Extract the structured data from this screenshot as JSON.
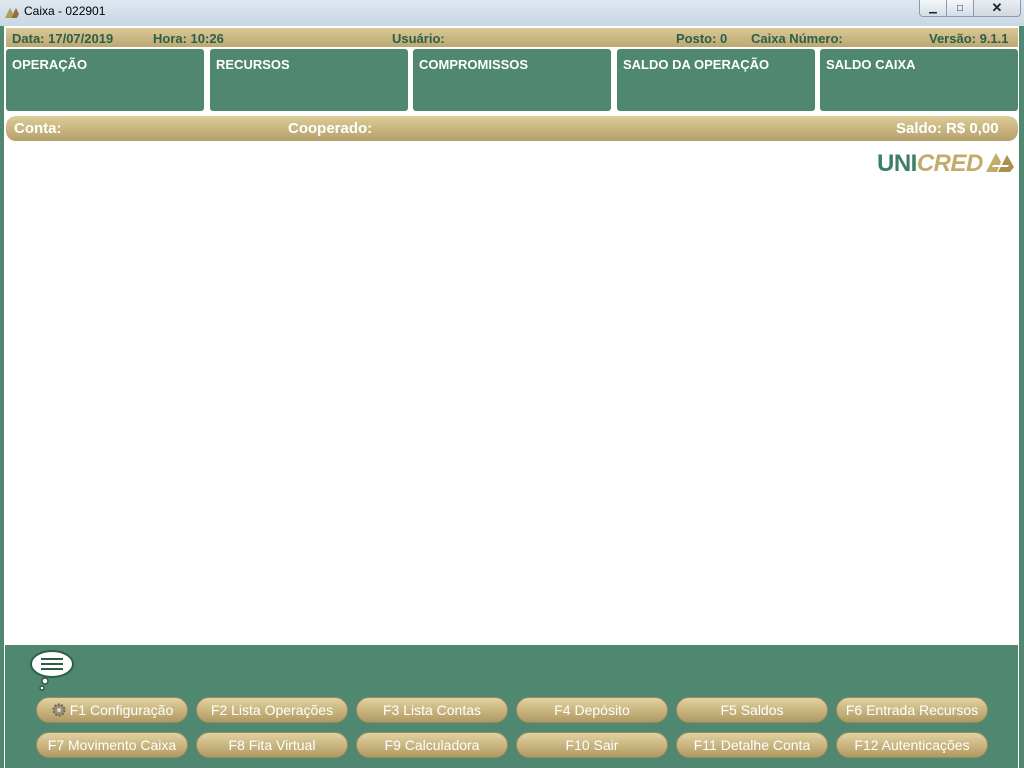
{
  "window": {
    "title": "Caixa - 022901",
    "min_label": "▁",
    "max_label": "□",
    "close_label": "✕"
  },
  "info": {
    "data": "Data: 17/07/2019",
    "hora": "Hora: 10:26",
    "usuario": "Usuário:",
    "posto": "Posto: 0",
    "caixa_numero": "Caixa Número:",
    "versao": "Versão: 9.1.1"
  },
  "panels": [
    {
      "label": "OPERAÇÃO"
    },
    {
      "label": "RECURSOS"
    },
    {
      "label": "COMPROMISSOS"
    },
    {
      "label": "SALDO DA OPERAÇÃO"
    },
    {
      "label": "SALDO CAIXA"
    }
  ],
  "account": {
    "conta": "Conta:",
    "cooperado": "Cooperado:",
    "saldo": "Saldo: R$ 0,00"
  },
  "logo": {
    "uni": "UNI",
    "cred": "CRED"
  },
  "fkeys": [
    {
      "label": "F1 Configuração",
      "icon": "gear-icon"
    },
    {
      "label": "F2 Lista Operações"
    },
    {
      "label": "F3 Lista Contas"
    },
    {
      "label": "F4 Depósito"
    },
    {
      "label": "F5 Saldos"
    },
    {
      "label": "F6 Entrada Recursos"
    },
    {
      "label": "F7 Movimento Caixa"
    },
    {
      "label": "F8 Fita Virtual"
    },
    {
      "label": "F9 Calculadora"
    },
    {
      "label": "F10 Sair"
    },
    {
      "label": "F11 Detalhe Conta"
    },
    {
      "label": "F12 Autenticações"
    }
  ],
  "colors": {
    "green": "#4f8770",
    "gold": "#c2ab6b",
    "info_text": "#2c5f48"
  }
}
